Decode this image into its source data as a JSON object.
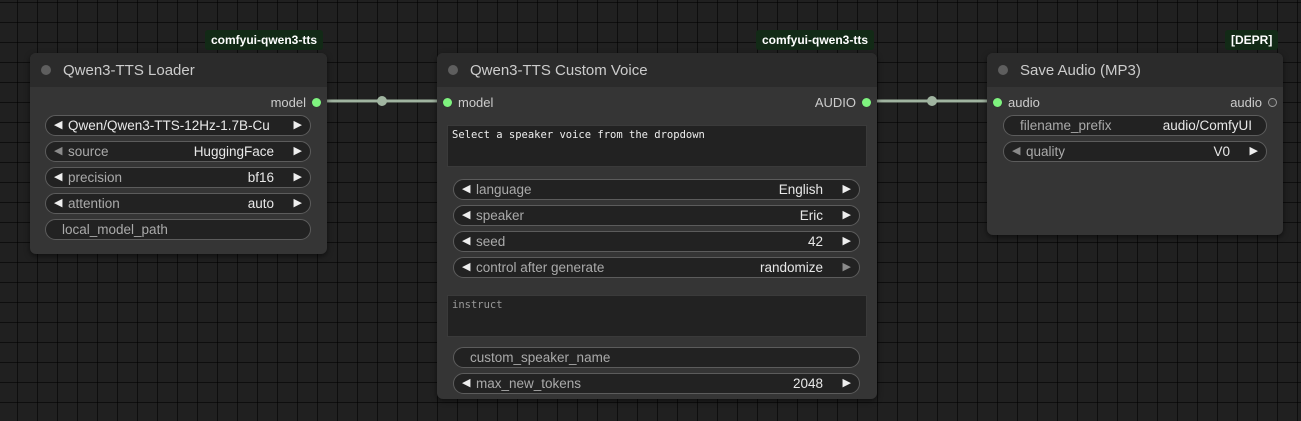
{
  "links_color": "#a0b4a0",
  "loader": {
    "badge": "comfyui-qwen3-tts",
    "title": "Qwen3-TTS Loader",
    "output_label": "model",
    "widgets": {
      "model_name": "Qwen/Qwen3-TTS-12Hz-1.7B-Cu",
      "source": {
        "label": "source",
        "value": "HuggingFace"
      },
      "precision": {
        "label": "precision",
        "value": "bf16"
      },
      "attention": {
        "label": "attention",
        "value": "auto"
      },
      "local_model_path": {
        "label": "local_model_path",
        "value": ""
      }
    }
  },
  "custom_voice": {
    "badge": "comfyui-qwen3-tts",
    "title": "Qwen3-TTS Custom Voice",
    "input_label": "model",
    "output_label": "AUDIO",
    "text_value": "Select a speaker voice from the dropdown",
    "widgets": {
      "language": {
        "label": "language",
        "value": "English"
      },
      "speaker": {
        "label": "speaker",
        "value": "Eric"
      },
      "seed": {
        "label": "seed",
        "value": "42"
      },
      "control_after_generate": {
        "label": "control after generate",
        "value": "randomize"
      },
      "instruct_placeholder": "instruct",
      "custom_speaker_name": {
        "label": "custom_speaker_name",
        "value": ""
      },
      "max_new_tokens": {
        "label": "max_new_tokens",
        "value": "2048"
      }
    }
  },
  "save_audio": {
    "badge": "[DEPR]",
    "title": "Save Audio (MP3)",
    "input_label": "audio",
    "output_label": "audio",
    "widgets": {
      "filename_prefix": {
        "label": "filename_prefix",
        "value": "audio/ComfyUI"
      },
      "quality": {
        "label": "quality",
        "value": "V0"
      }
    }
  }
}
